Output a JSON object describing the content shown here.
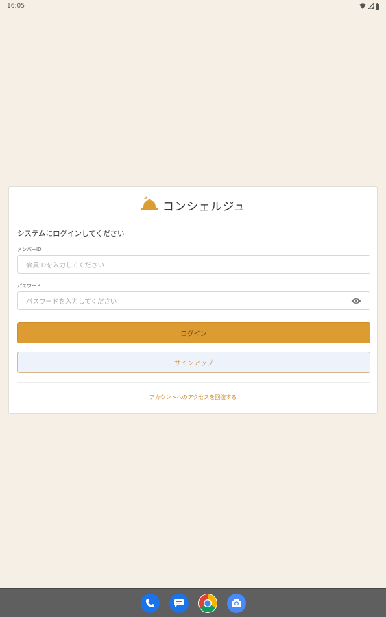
{
  "status_bar": {
    "time": "16:05",
    "icons": [
      "wifi-icon",
      "signal-icon",
      "battery-icon"
    ]
  },
  "brand": {
    "title": "コンシェルジュ",
    "icon": "bell-icon",
    "accent_color": "#dc9c32"
  },
  "login_form": {
    "heading": "システムにログインしてください",
    "member_id": {
      "label": "メンバーID",
      "placeholder": "会員IDを入力してください",
      "value": ""
    },
    "password": {
      "label": "パスワード",
      "placeholder": "パスワードを入力してください",
      "value": "",
      "toggle_icon": "eye-icon"
    },
    "login_button": "ログイン",
    "signup_button": "サインアップ",
    "recover_link": "アカウントへのアクセスを回復する"
  },
  "dock": {
    "apps": [
      {
        "name": "phone-icon",
        "color": "#1a73e8"
      },
      {
        "name": "messages-icon",
        "color": "#1a73e8"
      },
      {
        "name": "chrome-icon",
        "color": "#ffffff"
      },
      {
        "name": "camera-icon",
        "color": "#4a8af4"
      }
    ]
  }
}
